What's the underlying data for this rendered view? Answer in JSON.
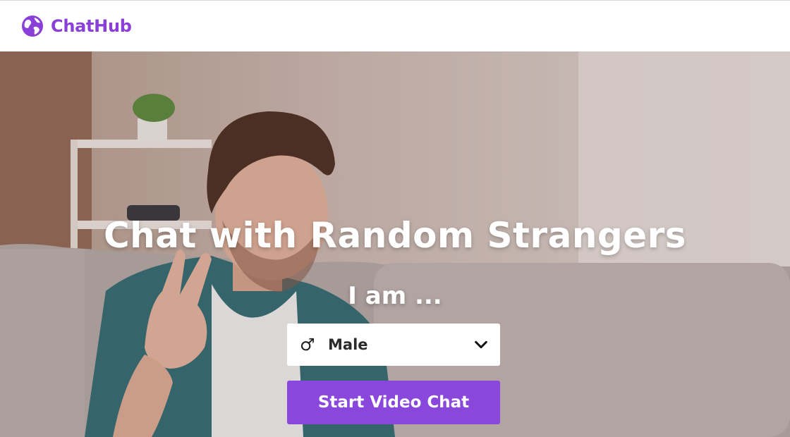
{
  "brand": {
    "name": "ChatHub",
    "logo_icon": "globe-icon",
    "color": "#8a3fd9"
  },
  "hero": {
    "headline": "Chat with Random Strangers",
    "prompt": "I am ...",
    "gender_select": {
      "icon": "male-symbol-icon",
      "glyph": "♂",
      "selected": "Male",
      "chevron_icon": "chevron-down-icon"
    },
    "cta_label": "Start Video Chat",
    "cta_color": "#8a47dc"
  }
}
